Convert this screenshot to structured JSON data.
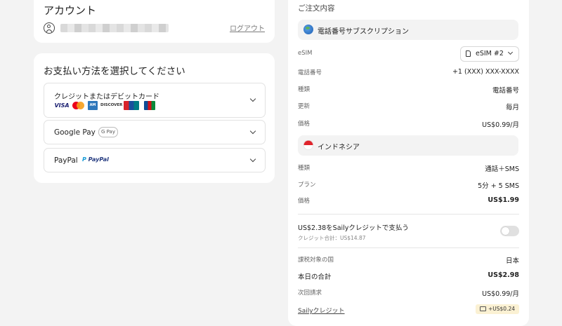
{
  "account": {
    "title": "アカウント",
    "logout_label": "ログアウト"
  },
  "payment": {
    "title": "お支払い方法を選択してください",
    "options": [
      {
        "label": "クレジットまたはデビットカード",
        "logos": [
          "VISA",
          "MC",
          "AMEX",
          "DISCOVER",
          "UnionPay",
          "JCB"
        ]
      },
      {
        "label": "Google Pay",
        "badge": "G Pay"
      },
      {
        "label": "PayPal",
        "logo": "PayPal"
      }
    ]
  },
  "order": {
    "title": "ご注文内容",
    "subscription": {
      "header": "電話番号サブスクリプション",
      "esim_label": "eSIM",
      "esim_selected": "eSIM #2",
      "rows": [
        {
          "k": "電話番号",
          "v": "+1 (XXX) XXX-XXXX"
        },
        {
          "k": "種類",
          "v": "電話番号"
        },
        {
          "k": "更新",
          "v": "毎月"
        },
        {
          "k": "価格",
          "v": "US$0.99/月"
        }
      ]
    },
    "plan": {
      "header": "インドネシア",
      "rows": [
        {
          "k": "種類",
          "v": "通話＋SMS"
        },
        {
          "k": "プラン",
          "v": "5分 + 5 SMS"
        },
        {
          "k": "価格",
          "v": "US$1.99"
        }
      ]
    },
    "credit": {
      "title": "US$2.38をSailyクレジットで支払う",
      "subtitle": "クレジット合計：US$14.87",
      "enabled": false
    },
    "totals": [
      {
        "k": "課税対象の国",
        "v": "日本"
      },
      {
        "k": "本日の合計",
        "v": "US$2.98"
      },
      {
        "k": "次回請求",
        "v": "US$0.99/月"
      }
    ],
    "saily_credit_link": "Sailyクレジット",
    "credit_badge": "+US$0.24"
  },
  "colors": {
    "background": "#f3f3f3",
    "card": "#ffffff",
    "badge_bg": "#fbf1d3"
  }
}
